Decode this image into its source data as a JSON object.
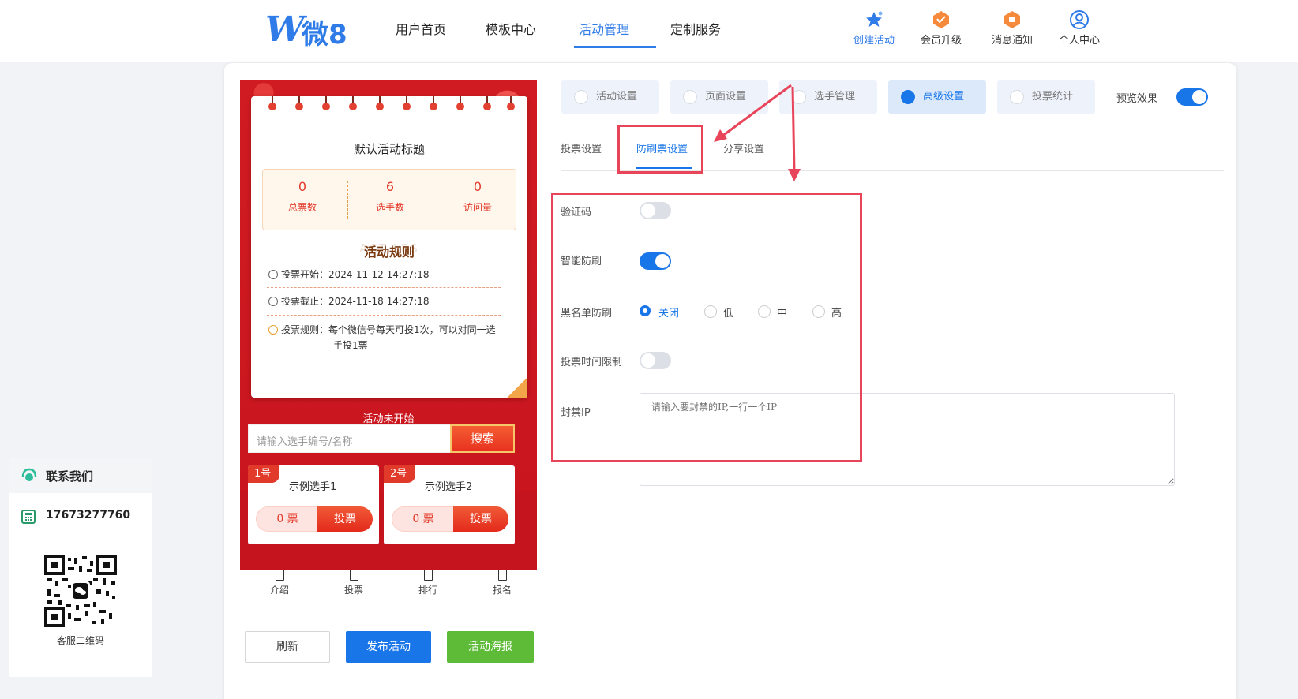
{
  "brand": {
    "logo_text": "微8"
  },
  "nav": [
    {
      "label": "用户首页",
      "active": false
    },
    {
      "label": "模板中心",
      "active": false
    },
    {
      "label": "活动管理",
      "active": true
    },
    {
      "label": "定制服务",
      "active": false
    }
  ],
  "top_actions": [
    {
      "label": "创建活动",
      "icon": "star-create-icon"
    },
    {
      "label": "会员升级",
      "icon": "vip-badge-icon"
    },
    {
      "label": "消息通知",
      "icon": "notification-badge-icon"
    },
    {
      "label": "个人中心",
      "icon": "user-circle-icon"
    }
  ],
  "preview": {
    "title": "默认活动标题",
    "stats": [
      {
        "value": "0",
        "label": "总票数"
      },
      {
        "value": "6",
        "label": "选手数"
      },
      {
        "value": "0",
        "label": "访问量"
      }
    ],
    "rules_title": "活动规则",
    "rules_ghost": "ACT         LES",
    "rules": [
      {
        "label": "投票开始：",
        "value": "2024-11-12 14:27:18"
      },
      {
        "label": "投票截止：",
        "value": "2024-11-18 14:27:18"
      },
      {
        "label": "投票规则：",
        "value": "每个微信号每天可投1次，可以对同一选手投1票"
      }
    ],
    "status": "活动未开始",
    "search_placeholder": "请输入选手编号/名称",
    "search_button": "搜索",
    "players": [
      {
        "no": "1号",
        "name": "示例选手1",
        "votes": "0 票",
        "vote_label": "投票"
      },
      {
        "no": "2号",
        "name": "示例选手2",
        "votes": "0 票",
        "vote_label": "投票"
      }
    ],
    "tabbar": [
      "介绍",
      "投票",
      "排行",
      "报名"
    ]
  },
  "actions": {
    "refresh": "刷新",
    "publish": "发布活动",
    "poster": "活动海报"
  },
  "settings_tabs": [
    {
      "label": "活动设置",
      "active": false
    },
    {
      "label": "页面设置",
      "active": false
    },
    {
      "label": "选手管理",
      "active": false
    },
    {
      "label": "高级设置",
      "active": true
    },
    {
      "label": "投票统计",
      "active": false
    }
  ],
  "preview_toggle": {
    "label": "预览效果",
    "on": true
  },
  "sub_tabs": [
    {
      "label": "投票设置",
      "active": false
    },
    {
      "label": "防刷票设置",
      "active": true
    },
    {
      "label": "分享设置",
      "active": false
    }
  ],
  "anti_fraud": {
    "captcha": {
      "label": "验证码",
      "on": false
    },
    "smart": {
      "label": "智能防刷",
      "on": true
    },
    "blacklist": {
      "label": "黑名单防刷",
      "options": [
        "关闭",
        "低",
        "中",
        "高"
      ],
      "selected": "关闭"
    },
    "time_limit": {
      "label": "投票时间限制",
      "on": false
    },
    "ban_ip": {
      "label": "封禁IP",
      "placeholder": "请输入要封禁的IP,一行一个IP"
    }
  },
  "contact": {
    "title": "联系我们",
    "phone": "17673277760",
    "qr_label": "客服二维码"
  },
  "colors": {
    "primary": "#1976e8",
    "highlight": "#e8445a",
    "phone_bg": "#c5141d",
    "accent_green": "#5dbb38"
  }
}
